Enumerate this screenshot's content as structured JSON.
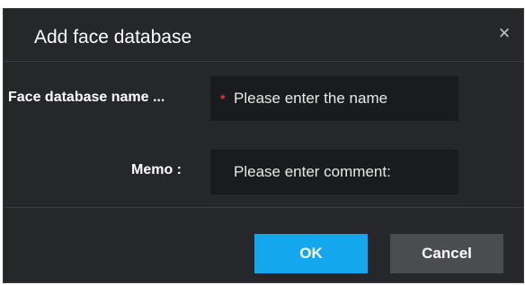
{
  "dialog": {
    "title": "Add face database",
    "close_glyph": "×"
  },
  "form": {
    "name_label": "Face database name ...",
    "name_required_mark": "*",
    "name_placeholder": "Please enter the name",
    "memo_label": "Memo :",
    "memo_placeholder": "Please enter comment:"
  },
  "footer": {
    "ok_label": "OK",
    "cancel_label": "Cancel"
  },
  "colors": {
    "dialog_bg": "#26272b",
    "input_bg": "#1a1b1e",
    "primary": "#15a7ee",
    "secondary": "#4b4c50",
    "required": "#e2362c"
  }
}
